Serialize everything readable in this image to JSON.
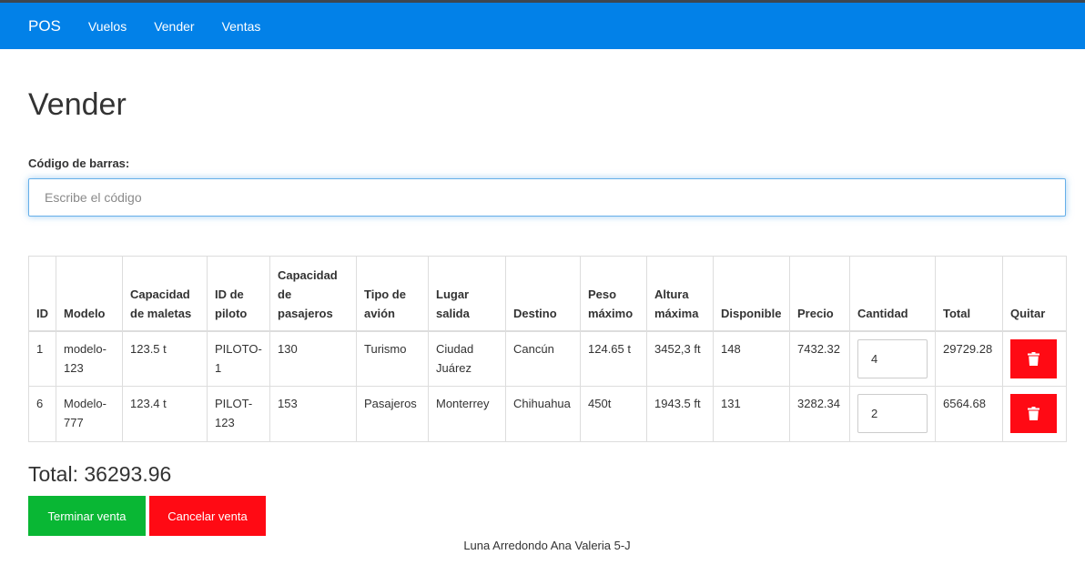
{
  "navbar": {
    "brand": "POS",
    "links": [
      "Vuelos",
      "Vender",
      "Ventas"
    ],
    "color": "#0281e8"
  },
  "page": {
    "title": "Vender",
    "barcode_label": "Código de barras:",
    "barcode_placeholder": "Escribe el código",
    "barcode_value": ""
  },
  "table": {
    "headers": [
      "ID",
      "Modelo",
      "Capacidad de maletas",
      "ID de piloto",
      "Capacidad de pasajeros",
      "Tipo de avión",
      "Lugar salida",
      "Destino",
      "Peso máximo",
      "Altura máxima",
      "Disponible",
      "Precio",
      "Cantidad",
      "Total",
      "Quitar"
    ],
    "rows": [
      {
        "id": "1",
        "modelo": "modelo-123",
        "maletas": "123.5 t",
        "piloto": "PILOTO-1",
        "pasajeros": "130",
        "tipo": "Turismo",
        "salida": "Ciudad Juárez",
        "destino": "Cancún",
        "peso": "124.65 t",
        "altura": "3452,3 ft",
        "disponible": "148",
        "precio": "7432.32",
        "cantidad": "4",
        "total": "29729.28",
        "quitar_icon": "trash-icon"
      },
      {
        "id": "6",
        "modelo": "Modelo-777",
        "maletas": "123.4 t",
        "piloto": "PILOT-123",
        "pasajeros": "153",
        "tipo": "Pasajeros",
        "salida": "Monterrey",
        "destino": "Chihuahua",
        "peso": "450t",
        "altura": "1943.5 ft",
        "disponible": "131",
        "precio": "3282.34",
        "cantidad": "2",
        "total": "6564.68",
        "quitar_icon": "trash-icon"
      }
    ]
  },
  "summary": {
    "total_label": "Total: 36293.96"
  },
  "actions": {
    "finish_label": "Terminar venta",
    "cancel_label": "Cancelar venta",
    "finish_color": "#09b734",
    "cancel_color": "#ff0a14"
  },
  "footer": {
    "text": "Luna Arredondo Ana Valeria 5-J"
  }
}
